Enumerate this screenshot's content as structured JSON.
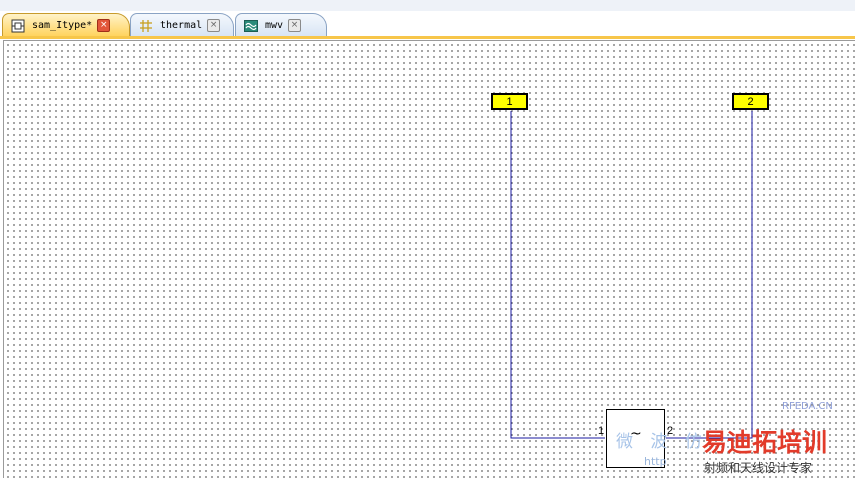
{
  "tabs": [
    {
      "label": "sam_Itype*",
      "active": true,
      "icon": "schematic-icon"
    },
    {
      "label": "thermal",
      "active": false,
      "icon": "thermal-grid-icon"
    },
    {
      "label": "mwv",
      "active": false,
      "icon": "wave-icon"
    }
  ],
  "tab_close_glyph": "×",
  "schematic": {
    "ports": [
      {
        "label": "1"
      },
      {
        "label": "2"
      }
    ],
    "component": {
      "symbol": "~",
      "pin_left": "1",
      "pin_right": "2"
    }
  },
  "watermark": {
    "site": "RFEDA.CN",
    "brand": "易迪拓培训",
    "tagline": "射频和天线设计专家",
    "chars": "微 波 仿",
    "url": "http"
  },
  "colors": {
    "active_tab": "#ffd25a",
    "port_fill": "#ffff00",
    "wire": "#1a1aa0"
  }
}
